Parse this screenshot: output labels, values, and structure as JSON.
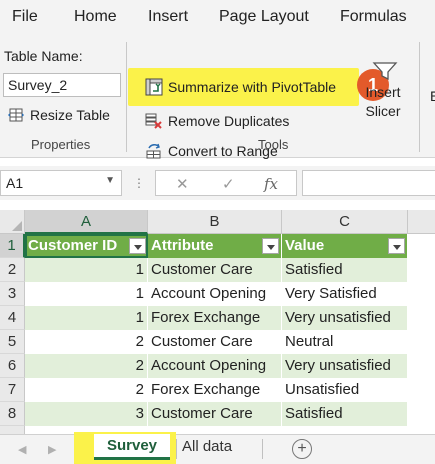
{
  "menu": {
    "items": [
      "File",
      "Home",
      "Insert",
      "Page Layout",
      "Formulas"
    ]
  },
  "ribbon": {
    "table_name_label": "Table Name:",
    "table_name_value": "Survey_2",
    "resize_table": "Resize Table",
    "properties_group": "Properties",
    "summarize_pivot": "Summarize with PivotTable",
    "remove_duplicates": "Remove Duplicates",
    "convert_to_range": "Convert to Range",
    "tools_group": "Tools",
    "insert_slicer_line1": "Insert",
    "insert_slicer_line2": "Slicer",
    "step_badge": "1",
    "partial_label": "E"
  },
  "formula_bar": {
    "name_box": "A1",
    "cancel_symbol": "✕",
    "enter_symbol": "✓",
    "fx_symbol": "fx",
    "formula_value": ""
  },
  "grid": {
    "columns": [
      "A",
      "B",
      "C"
    ],
    "rows": [
      "1",
      "2",
      "3",
      "4",
      "5",
      "6",
      "7",
      "8"
    ],
    "headers": [
      "Customer ID",
      "Attribute",
      "Value"
    ],
    "data": [
      [
        "1",
        "Customer Care",
        "Satisfied"
      ],
      [
        "1",
        "Account Opening",
        "Very Satisfied"
      ],
      [
        "1",
        "Forex Exchange",
        "Very unsatisfied"
      ],
      [
        "2",
        "Customer Care",
        "Neutral"
      ],
      [
        "2",
        "Account Opening",
        "Very unsatisfied"
      ],
      [
        "2",
        "Forex Exchange",
        "Unsatisfied"
      ],
      [
        "3",
        "Customer Care",
        "Satisfied"
      ]
    ]
  },
  "sheets": {
    "active": "Survey",
    "other": "All data",
    "add_symbol": "+"
  },
  "colors": {
    "header_fill": "#70ad47",
    "band_fill": "#e2efda",
    "highlight": "#fbf24a",
    "badge": "#e35a2b",
    "excel_green": "#217346"
  }
}
